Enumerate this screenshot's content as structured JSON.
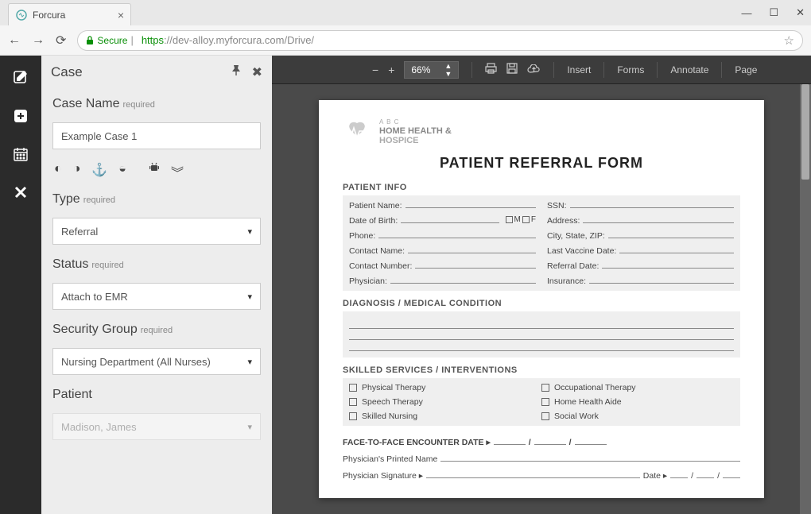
{
  "browser": {
    "tab_title": "Forcura",
    "secure_label": "Secure",
    "url_proto": "https",
    "url_host": "://dev-alloy.myforcura.com",
    "url_path": "/Drive/"
  },
  "panel": {
    "title": "Case",
    "case_name": {
      "label": "Case Name",
      "req": "required",
      "value": "Example Case 1"
    },
    "type": {
      "label": "Type",
      "req": "required",
      "value": "Referral"
    },
    "status": {
      "label": "Status",
      "req": "required",
      "value": "Attach to EMR"
    },
    "security_group": {
      "label": "Security Group",
      "req": "required",
      "value": "Nursing Department (All Nurses)"
    },
    "patient": {
      "label": "Patient",
      "value": "Madison, James"
    }
  },
  "viewer": {
    "zoom": "66%",
    "menu": {
      "insert": "Insert",
      "forms": "Forms",
      "annotate": "Annotate",
      "page": "Page"
    }
  },
  "form": {
    "logo": {
      "l1": "A B C",
      "l2": "HOME HEALTH &",
      "l3": "HOSPICE"
    },
    "title": "PATIENT REFERRAL FORM",
    "sect_patient": "PATIENT INFO",
    "fields": {
      "patient_name": "Patient Name:",
      "ssn": "SSN:",
      "dob": "Date of Birth:",
      "mf_m": "M",
      "mf_f": "F",
      "address": "Address:",
      "phone": "Phone:",
      "csz": "City, State, ZIP:",
      "contact_name": "Contact Name:",
      "last_vaccine": "Last Vaccine Date:",
      "contact_number": "Contact Number:",
      "referral_date": "Referral Date:",
      "physician": "Physician:",
      "insurance": "Insurance:"
    },
    "sect_diag": "DIAGNOSIS / MEDICAL CONDITION",
    "sect_services": "SKILLED SERVICES / INTERVENTIONS",
    "services": {
      "pt": "Physical Therapy",
      "ot": "Occupational Therapy",
      "st": "Speech Therapy",
      "hha": "Home Health Aide",
      "sn": "Skilled Nursing",
      "sw": "Social Work"
    },
    "f2f": "FACE-TO-FACE ENCOUNTER DATE ▸",
    "phys_name": "Physician's Printed Name",
    "phys_sig": "Physician Signature ▸",
    "date_lbl": "Date ▸"
  }
}
